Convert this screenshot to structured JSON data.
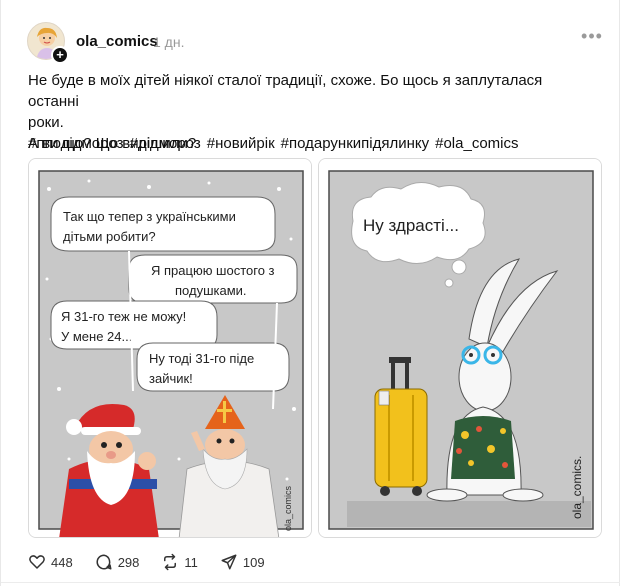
{
  "post": {
    "username": "ola_comics",
    "time": "1 дн.",
    "more_icon": "more-horizontal-icon",
    "text_lines": [
      "Не буде в моїх дітей ніякої сталої традиції, схоже. Бо щось я заплуталася останні",
      "роки.",
      "А ви що? Що вирішили?"
    ],
    "hashtags": [
      "#пподідмороз",
      "#дідмороз",
      "#новийрік",
      "#подарункипідялинку",
      "#ola_comics"
    ]
  },
  "comic_left": {
    "bubble_1": [
      "Так що тепер з українськими",
      "дітьми робити?"
    ],
    "bubble_2": [
      "Я працюю шостого з",
      "подушками."
    ],
    "bubble_3": [
      "Я 31-го теж не можу!",
      "У мене 24..."
    ],
    "bubble_4": [
      "Ну тоді 31-го піде",
      "зайчик!"
    ],
    "signature": "ola_comics"
  },
  "comic_right": {
    "bubble": "Ну здрасті...",
    "signature": "ola_comics."
  },
  "actions": {
    "likes": "448",
    "comments": "298",
    "reposts": "11",
    "shares": "109"
  },
  "colors": {
    "comic_bg": "#c8c8c8",
    "santa_red": "#d62a2a",
    "suitcase_yellow": "#f2c11c",
    "glasses_blue": "#3ab6e8"
  }
}
